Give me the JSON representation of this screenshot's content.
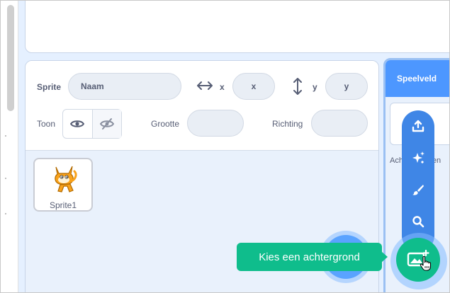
{
  "sprite_info": {
    "sprite_label": "Sprite",
    "name_placeholder": "Naam",
    "x_label": "x",
    "x_placeholder": "x",
    "y_label": "y",
    "y_placeholder": "y",
    "show_label": "Toon",
    "size_label": "Grootte",
    "size_value": "",
    "direction_label": "Richting",
    "direction_value": ""
  },
  "sprites": [
    {
      "name": "Sprite1",
      "icon": "cat-sprite-icon"
    }
  ],
  "stage_panel": {
    "header": "Speelveld",
    "sub_label": "Achtergronden"
  },
  "backdrop_menu": {
    "items": [
      {
        "icon": "upload-icon"
      },
      {
        "icon": "surprise-icon"
      },
      {
        "icon": "paint-icon"
      },
      {
        "icon": "search-icon"
      }
    ],
    "main_button_icon": "choose-backdrop-icon",
    "tooltip": "Kies een achtergrond"
  },
  "colors": {
    "accent_blue": "#4d97ff",
    "menu_blue": "#3f86e6",
    "green": "#0fbd8c",
    "text": "#575e75"
  }
}
